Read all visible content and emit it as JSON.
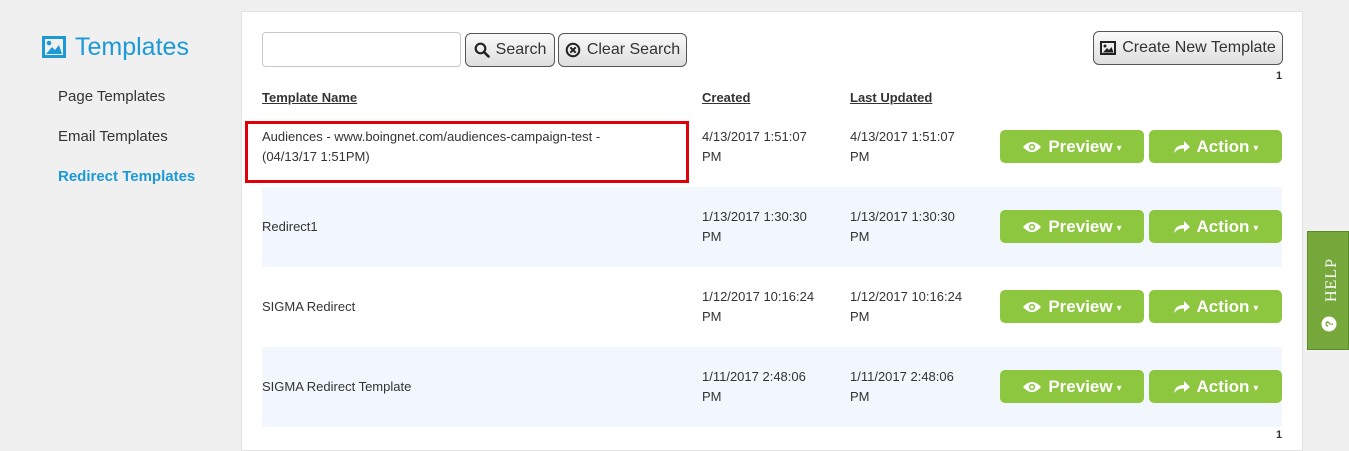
{
  "sidebar": {
    "title": "Templates",
    "items": [
      {
        "label": "Page Templates"
      },
      {
        "label": "Email Templates"
      },
      {
        "label": "Redirect Templates"
      }
    ]
  },
  "toolbar": {
    "search_value": "",
    "search_label": "Search",
    "clear_label": "Clear Search",
    "create_label": "Create New Template"
  },
  "pagination": {
    "top_page": "1",
    "bottom_page": "1"
  },
  "table": {
    "headers": {
      "name": "Template Name",
      "created": "Created",
      "updated": "Last Updated"
    },
    "rows": [
      {
        "name_line1": "Audiences - www.boingnet.com/audiences-campaign-test -",
        "name_line2": "(04/13/17 1:51PM)",
        "created_line1": "4/13/2017 1:51:07",
        "created_line2": "PM",
        "updated_line1": "4/13/2017 1:51:07",
        "updated_line2": "PM"
      },
      {
        "name_line1": "Redirect1",
        "name_line2": "",
        "created_line1": "1/13/2017 1:30:30",
        "created_line2": "PM",
        "updated_line1": "1/13/2017 1:30:30",
        "updated_line2": "PM"
      },
      {
        "name_line1": "SIGMA Redirect",
        "name_line2": "",
        "created_line1": "1/12/2017 10:16:24",
        "created_line2": "PM",
        "updated_line1": "1/12/2017 10:16:24",
        "updated_line2": "PM"
      },
      {
        "name_line1": "SIGMA Redirect Template",
        "name_line2": "",
        "created_line1": "1/11/2017 2:48:06",
        "created_line2": "PM",
        "updated_line1": "1/11/2017 2:48:06",
        "updated_line2": "PM"
      }
    ],
    "preview_label": "Preview",
    "action_label": "Action"
  },
  "help": {
    "label": "HELP"
  },
  "colors": {
    "accent": "#1d9ad6",
    "button_green": "#8dc63f",
    "help_green": "#76a83b",
    "highlight": "#e0000a",
    "alt_row": "#f1f7fd"
  },
  "icons": [
    "image-icon",
    "search-icon",
    "clear-circle-x-icon",
    "eye-icon",
    "share-arrow-icon",
    "question-icon"
  ]
}
